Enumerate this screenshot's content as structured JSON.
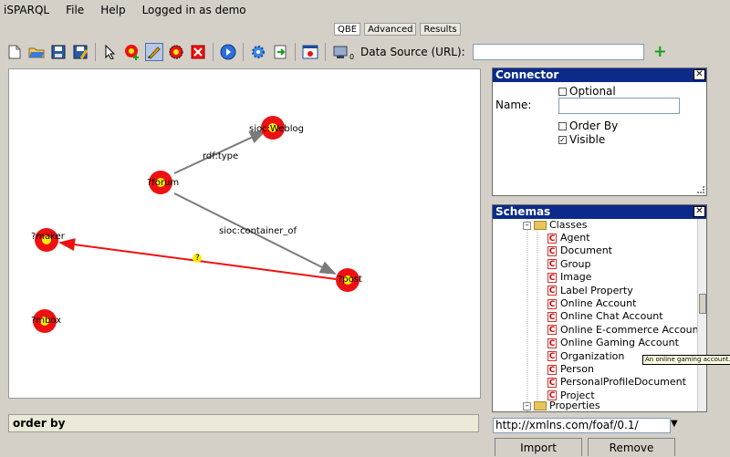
{
  "menubar": {
    "app": "iSPARQL",
    "file": "File",
    "help": "Help",
    "login": "Logged in as demo"
  },
  "tabs": [
    "QBE",
    "Advanced",
    "Results"
  ],
  "toolbar": {
    "datasource_label": "Data Source (URL):",
    "datasource_value": "",
    "count_badge": "0"
  },
  "graph": {
    "nodes": [
      {
        "id": "blog",
        "label": "sioc:Weblog"
      },
      {
        "id": "forum",
        "label": "?forum"
      },
      {
        "id": "maker",
        "label": "?maker"
      },
      {
        "id": "post",
        "label": "?post"
      },
      {
        "id": "mbox",
        "label": "?mbox"
      }
    ],
    "edges": [
      {
        "from": "forum",
        "to": "blog",
        "label": "rdf:type",
        "color": "#7a7a7a"
      },
      {
        "from": "forum",
        "to": "post",
        "label": "sioc:container_of",
        "color": "#7a7a7a"
      },
      {
        "from": "post",
        "to": "maker",
        "label": "?",
        "color": "#ee1111"
      }
    ]
  },
  "orderby": {
    "label": "order by"
  },
  "connector": {
    "title": "Connector",
    "name_label": "Name:",
    "name_value": "",
    "optional_label": "Optional",
    "optional_checked": false,
    "orderby_label": "Order By",
    "orderby_checked": false,
    "visible_label": "Visible",
    "visible_checked": true
  },
  "schemas": {
    "title": "Schemas",
    "root": "Classes",
    "items": [
      "Agent",
      "Document",
      "Group",
      "Image",
      "Label Property",
      "Online Account",
      "Online Chat Account",
      "Online E-commerce Account",
      "Online Gaming Account",
      "Organization",
      "Person",
      "PersonalProfileDocument",
      "Project"
    ],
    "next": "Properties",
    "tooltip": "An online gaming account.",
    "namespace": "http://xmlns.com/foaf/0.1/",
    "import_label": "Import",
    "remove_label": "Remove"
  }
}
